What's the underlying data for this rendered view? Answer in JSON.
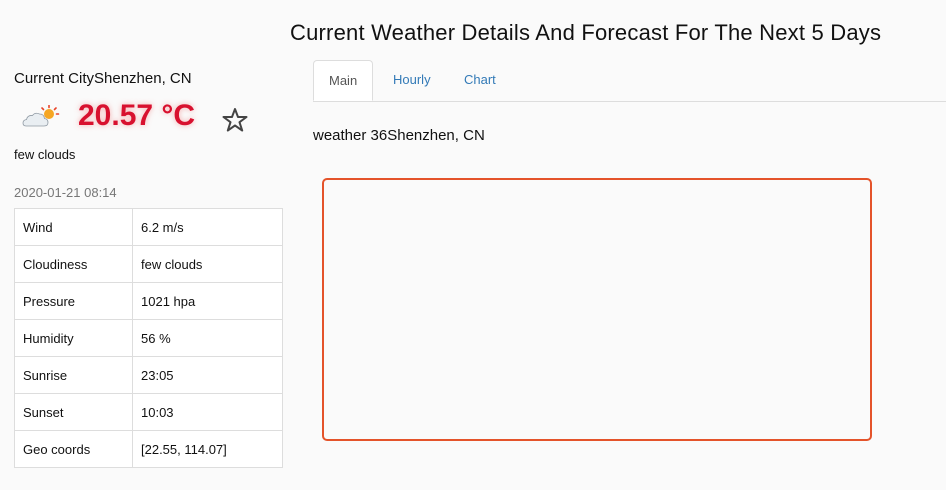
{
  "title": "Current Weather Details And Forecast For The Next 5 Days",
  "sidebar": {
    "city": "Current CityShenzhen, CN",
    "temperature": "20.57 °C",
    "description": "few clouds",
    "timestamp": "2020-01-21 08:14",
    "icon": "few-clouds-icon",
    "details": [
      {
        "label": "Wind",
        "value": "6.2 m/s"
      },
      {
        "label": "Cloudiness",
        "value": "few clouds"
      },
      {
        "label": "Pressure",
        "value": "1021 hpa"
      },
      {
        "label": "Humidity",
        "value": "56 %"
      },
      {
        "label": "Sunrise",
        "value": "23:05"
      },
      {
        "label": "Sunset",
        "value": "10:03"
      },
      {
        "label": "Geo coords",
        "value": "[22.55, 114.07]"
      }
    ]
  },
  "tabs": [
    {
      "label": "Main",
      "active": true
    },
    {
      "label": "Hourly",
      "active": false
    },
    {
      "label": "Chart",
      "active": false
    }
  ],
  "main": {
    "subtitle": "weather 36Shenzhen, CN"
  },
  "colors": {
    "temperature": "#d8112f",
    "panel_border": "#e4532a",
    "tab_link": "#337ab7"
  }
}
